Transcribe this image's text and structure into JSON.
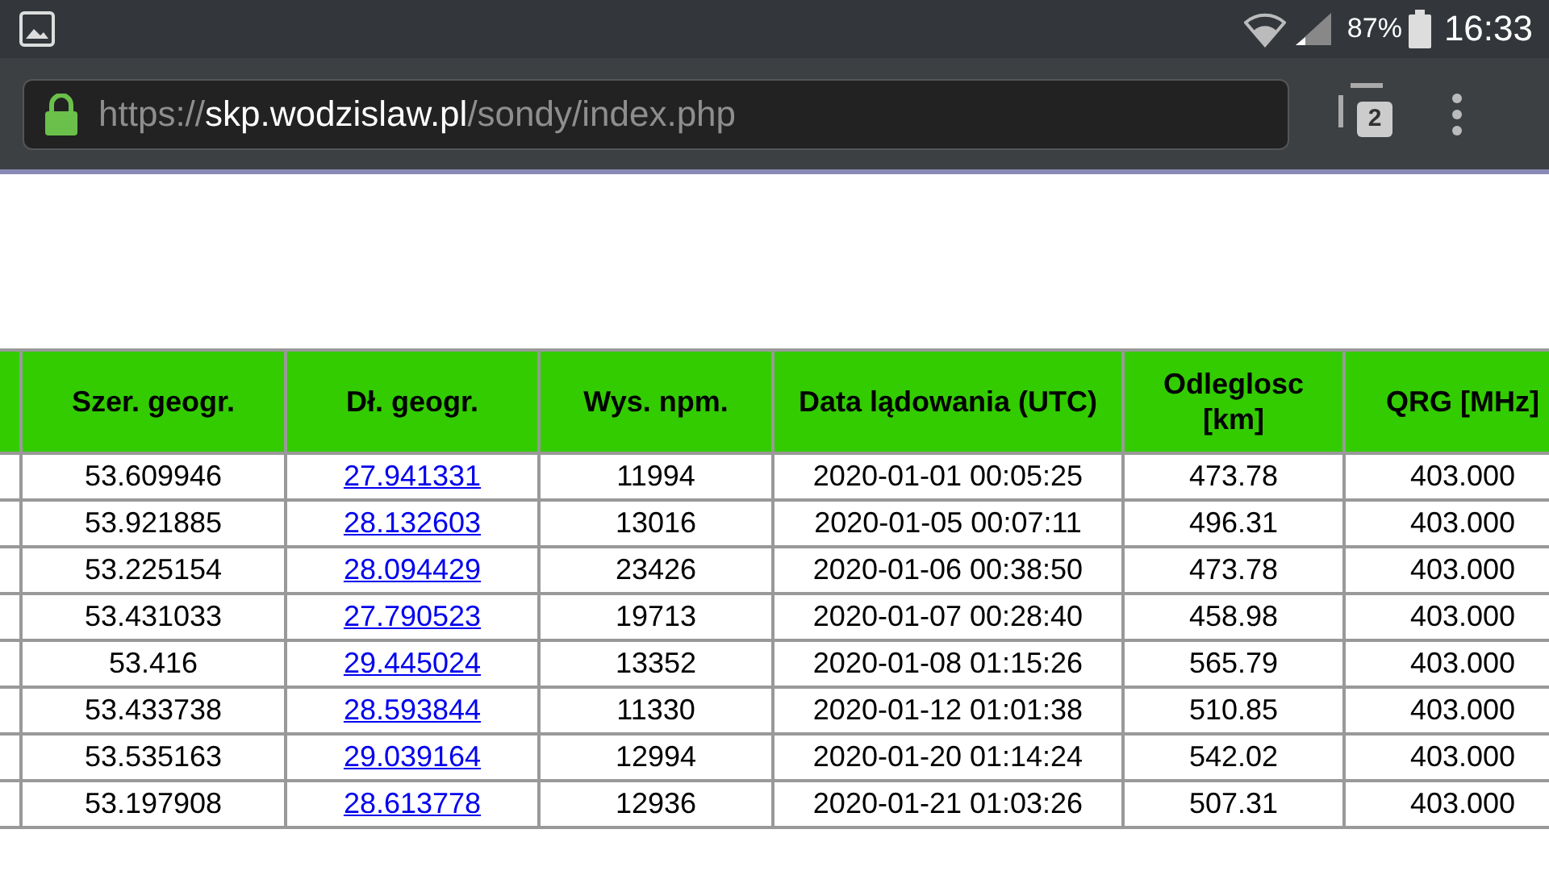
{
  "status_bar": {
    "battery": "87%",
    "time": "16:33"
  },
  "browser": {
    "url": {
      "scheme": "https://",
      "host": "skp.wodzislaw.pl",
      "path": "/sondy/index.php"
    },
    "tab_count": "2"
  },
  "table": {
    "columns": [
      "Szer. geogr.",
      "Dł. geogr.",
      "Wys. npm.",
      "Data lądowania (UTC)",
      "Odleglosc [km]",
      "QRG [MHz]"
    ],
    "rows": [
      [
        "53.609946",
        "27.941331",
        "11994",
        "2020-01-01 00:05:25",
        "473.78",
        "403.000"
      ],
      [
        "53.921885",
        "28.132603",
        "13016",
        "2020-01-05 00:07:11",
        "496.31",
        "403.000"
      ],
      [
        "53.225154",
        "28.094429",
        "23426",
        "2020-01-06 00:38:50",
        "473.78",
        "403.000"
      ],
      [
        "53.431033",
        "27.790523",
        "19713",
        "2020-01-07 00:28:40",
        "458.98",
        "403.000"
      ],
      [
        "53.416",
        "29.445024",
        "13352",
        "2020-01-08 01:15:26",
        "565.79",
        "403.000"
      ],
      [
        "53.433738",
        "28.593844",
        "11330",
        "2020-01-12 01:01:38",
        "510.85",
        "403.000"
      ],
      [
        "53.535163",
        "29.039164",
        "12994",
        "2020-01-20 01:14:24",
        "542.02",
        "403.000"
      ],
      [
        "53.197908",
        "28.613778",
        "12936",
        "2020-01-21 01:03:26",
        "507.31",
        "403.000"
      ]
    ]
  }
}
